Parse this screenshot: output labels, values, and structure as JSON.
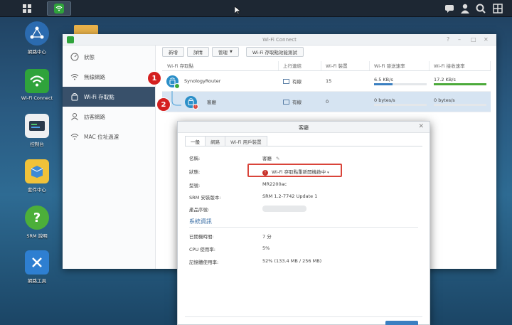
{
  "taskbar": {
    "wifi_app": "wifi-connect"
  },
  "desktop": {
    "icons": [
      {
        "label": "網路中心"
      },
      {
        "label": "Wi-Fi Connect"
      },
      {
        "label": "控制台"
      },
      {
        "label": "套件中心"
      },
      {
        "label": "SRM 說明"
      },
      {
        "label": "網路工具"
      }
    ]
  },
  "window": {
    "title": "Wi-Fi Connect",
    "sidebar": [
      {
        "label": "狀態",
        "icon": "gauge-icon"
      },
      {
        "label": "無線網路",
        "icon": "wifi-icon"
      },
      {
        "label": "Wi-Fi 存取點",
        "icon": "router-icon"
      },
      {
        "label": "訪客網路",
        "icon": "guest-icon"
      },
      {
        "label": "MAC 位址過濾",
        "icon": "filter-icon"
      }
    ],
    "toolbar": {
      "add": "新增",
      "detail": "詳情",
      "manage": "管理",
      "test": "Wi-Fi 存取點效能測試"
    },
    "table": {
      "headers": [
        "Wi-Fi 存取點",
        "上行連結",
        "Wi-Fi 裝置",
        "Wi-Fi 發送速率",
        "Wi-Fi 接收速率"
      ],
      "rows": [
        {
          "name": "SynologyRouter",
          "uplink": "有線",
          "devices": "15",
          "tx": "6.5 KB/s",
          "rx": "17.2 KB/s",
          "tx_level": 0.35,
          "rx_level": 1.0
        },
        {
          "name": "客廳",
          "uplink": "有線",
          "devices": "0",
          "tx": "0 bytes/s",
          "rx": "0 bytes/s",
          "tx_level": 0,
          "rx_level": 0
        }
      ]
    }
  },
  "markers": [
    "1",
    "2"
  ],
  "dialog": {
    "title": "客廳",
    "tabs": [
      "一般",
      "網路",
      "Wi-Fi 用戶裝置"
    ],
    "fields": [
      {
        "label": "名稱:",
        "value": "客廳"
      },
      {
        "label": "狀態:",
        "value": "Wi-Fi 存取點重新開機啟中"
      },
      {
        "label": "型號:",
        "value": "MR2200ac"
      },
      {
        "label": "SRM 安裝版本:",
        "value": "SRM 1.2-7742 Update 1"
      },
      {
        "label": "產品序號:",
        "value": ""
      }
    ],
    "section": "系統資訊",
    "sysinfo": [
      {
        "label": "已開機時間:",
        "value": "7 分"
      },
      {
        "label": "CPU 使用率:",
        "value": "5%"
      },
      {
        "label": "記憶體使用率:",
        "value": "52% (133.4 MB / 256 MB)"
      }
    ]
  },
  "colors": {
    "accent": "#38506a",
    "error": "#d9443a",
    "tx_bar": "#3a7fc1",
    "rx_bar": "#4caa3a"
  }
}
